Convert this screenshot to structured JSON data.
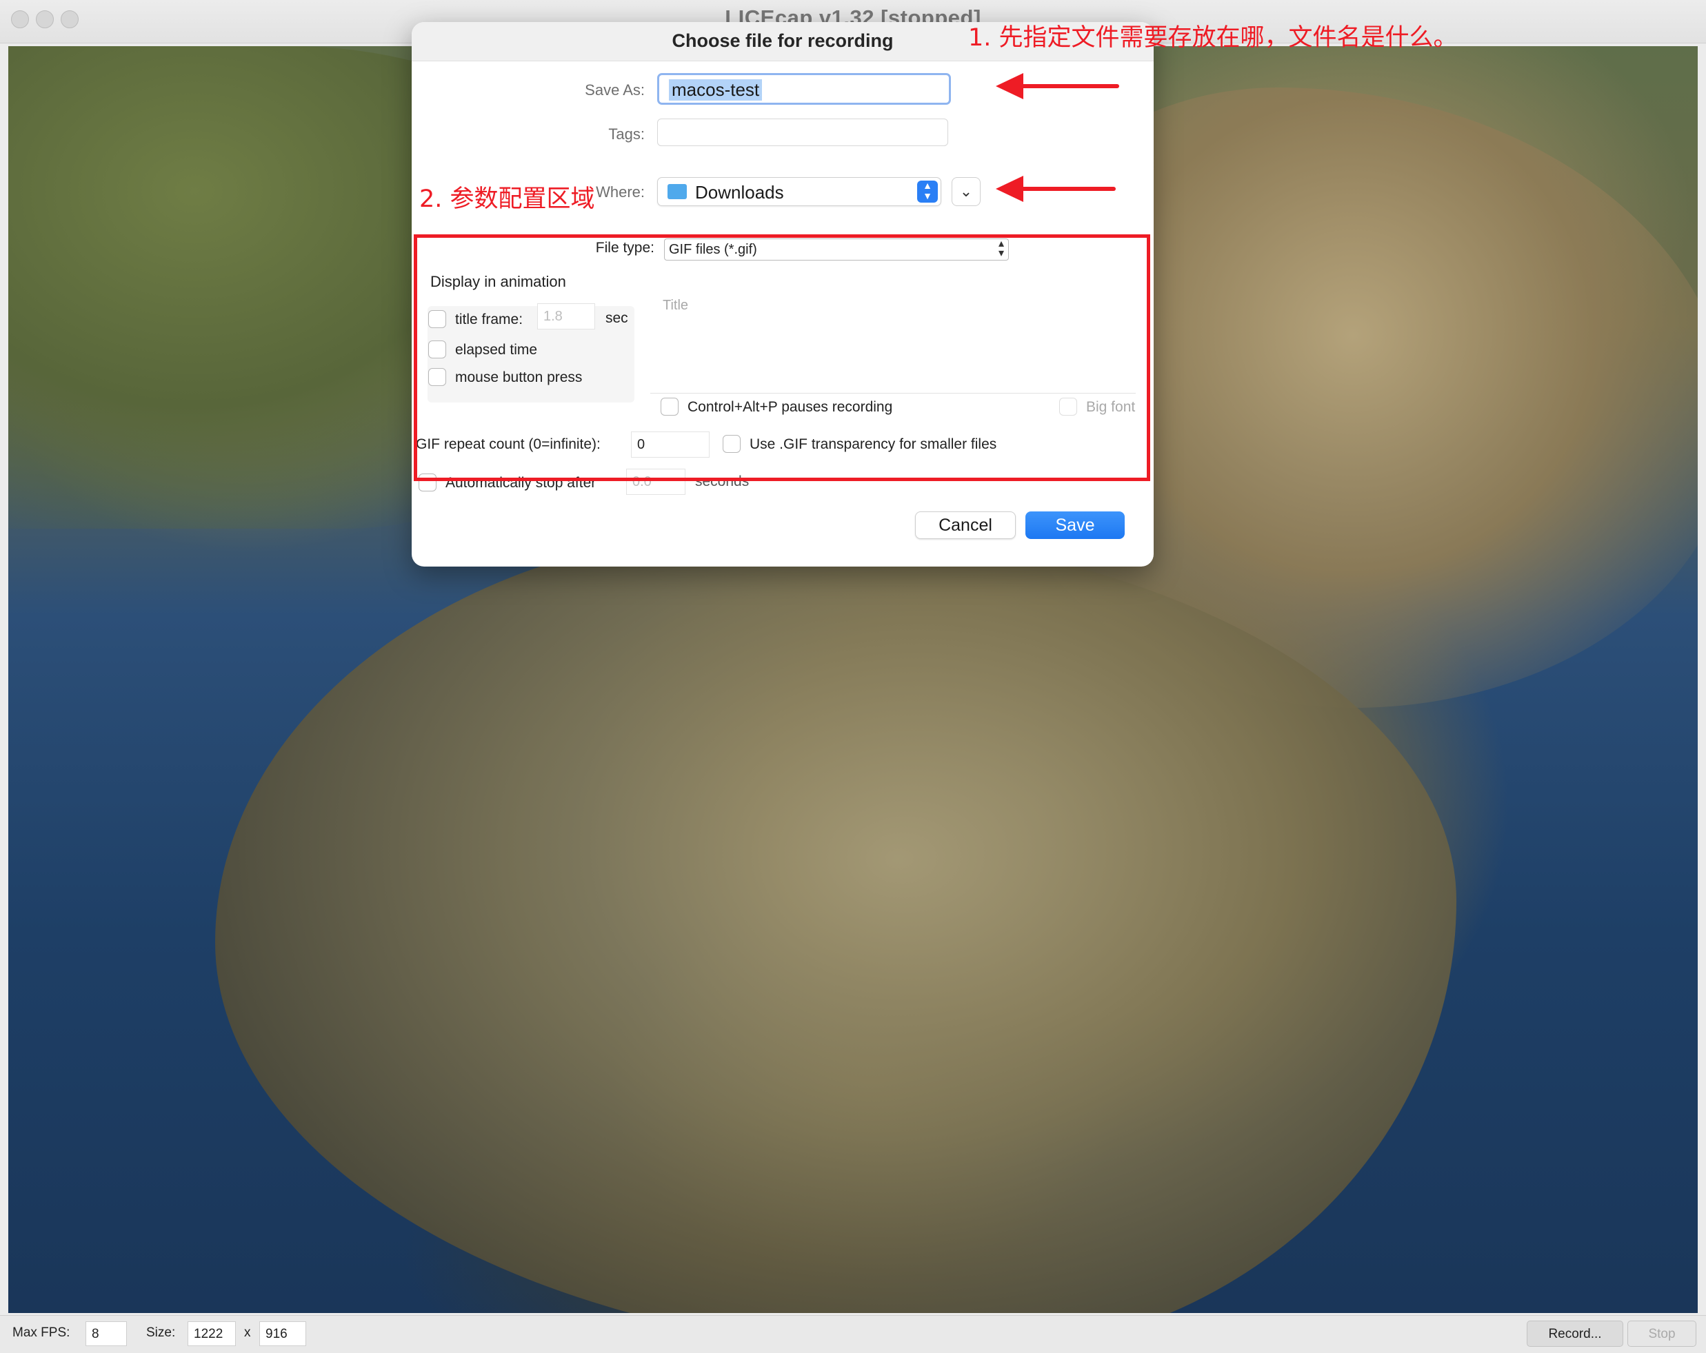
{
  "window": {
    "title": "LICEcap v1.32 [stopped]"
  },
  "dialog": {
    "title": "Choose file for recording",
    "save_as_label": "Save As:",
    "save_as_value": "macos-test",
    "tags_label": "Tags:",
    "tags_value": "",
    "where_label": "Where:",
    "where_value": "Downloads",
    "file_type_label": "File type:",
    "file_type_value": "GIF files (*.gif)",
    "display_in_animation": "Display in animation",
    "title_frame_label": "title frame:",
    "title_frame_seconds": "1.8",
    "sec_label": "sec",
    "elapsed_time_label": "elapsed time",
    "mouse_button_label": "mouse button press",
    "title_placeholder": "Title",
    "pause_label": "Control+Alt+P pauses recording",
    "big_font_label": "Big font",
    "repeat_label": "GIF repeat count (0=infinite):",
    "repeat_value": "0",
    "transparency_label": "Use .GIF transparency for smaller files",
    "auto_stop_label": "Automatically stop after",
    "auto_stop_value": "0.0",
    "seconds_label": "seconds",
    "cancel_label": "Cancel",
    "save_label": "Save"
  },
  "annotations": {
    "note1": "1. 先指定文件需要存放在哪，文件名是什么。",
    "note2": "2. 参数配置区域",
    "accent_color": "#ee1c25"
  },
  "statusbar": {
    "max_fps_label": "Max FPS:",
    "max_fps_value": "8",
    "size_label": "Size:",
    "width_value": "1222",
    "x_label": "x",
    "height_value": "916",
    "record_label": "Record...",
    "stop_label": "Stop"
  }
}
